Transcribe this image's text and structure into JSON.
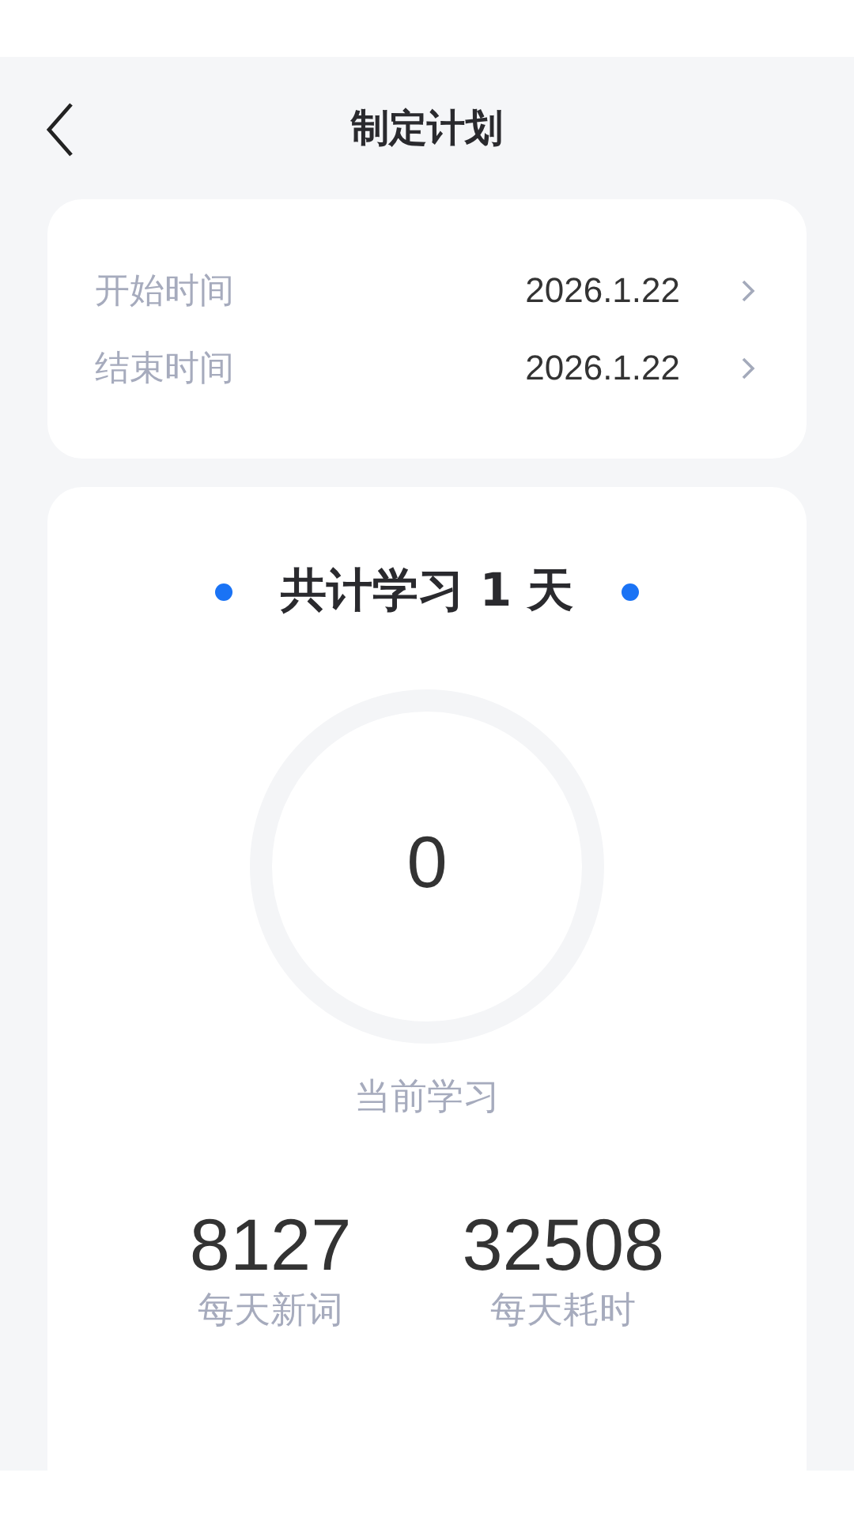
{
  "header": {
    "title": "制定计划"
  },
  "dates": [
    {
      "label": "开始时间",
      "value": "2026.1.22"
    },
    {
      "label": "结束时间",
      "value": "2026.1.22"
    }
  ],
  "summary": {
    "title": "共计学习 1 天",
    "progress": {
      "value": "0",
      "caption": "当前学习"
    },
    "stats": [
      {
        "value": "8127",
        "label": "每天新词"
      },
      {
        "value": "32508",
        "label": "每天耗时"
      }
    ]
  }
}
